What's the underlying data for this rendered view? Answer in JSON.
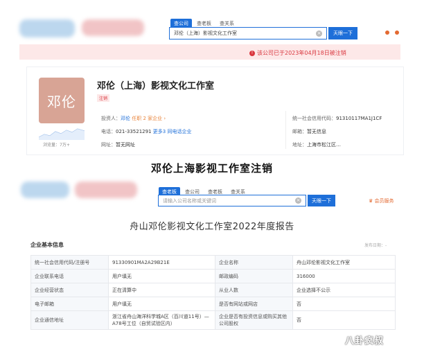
{
  "top": {
    "tabs": [
      "查公司",
      "查老板",
      "查关系"
    ],
    "search_value": "邓伦（上海）影视文化工作室",
    "search_button": "天眼一下",
    "notice": "该公司已于2023年04月18日被注销",
    "company": {
      "logo_text": "邓伦",
      "name": "邓伦（上海）影视文化工作室",
      "status": "注销",
      "browse": "浏览量：7万+",
      "investor_label": "投资人：",
      "investor_name": "邓伦",
      "investor_extra": "任职 2 家企业 ›",
      "phone_label": "电话：",
      "phone": "021-33521291",
      "phone_more": "更多3",
      "phone_same": "同电话企业",
      "website_label": "网址：",
      "website": "暂无网址",
      "credit_label": "统一社会信用代码：",
      "credit_code": "91310117MA1J1CF",
      "email_label": "邮箱：",
      "email": "暂无信息",
      "address_label": "地址：",
      "address": "上海市松江区…"
    }
  },
  "caption": "邓伦上海影视工作室注销",
  "bottom": {
    "tabs": [
      "查老板",
      "查公司",
      "查老板",
      "查关系"
    ],
    "search_placeholder": "请输入公司名称或关键词",
    "search_button": "天眼一下",
    "right_link": "会员服务",
    "report_title": "舟山邓伦影视文化工作室2022年度报告",
    "section_title": "企业基本信息",
    "section_hint": "发布日期：-",
    "rows": [
      [
        "统一社会信用代码/注册号",
        "91330901MA2A29B21E",
        "企业名称",
        "舟山邓伦影视文化工作室"
      ],
      [
        "企业联系电话",
        "用户填无",
        "邮政编码",
        "316000"
      ],
      [
        "企业经营状态",
        "正在清算中",
        "从业人数",
        "企业选择不公示"
      ],
      [
        "电子邮箱",
        "用户填无",
        "是否有网站或网店",
        "否"
      ],
      [
        "企业通信地址",
        "浙江省舟山海洋科学城A区（百川道11号）—A78号工位（自贸试验区内）",
        "企业是否有投资信息或购买其他公司股权",
        "否"
      ]
    ],
    "watermark": "八卦疯叔"
  },
  "colors": {
    "accent": "#1e6fd9",
    "danger": "#d9363e",
    "logo_bg": "#d8a495"
  }
}
